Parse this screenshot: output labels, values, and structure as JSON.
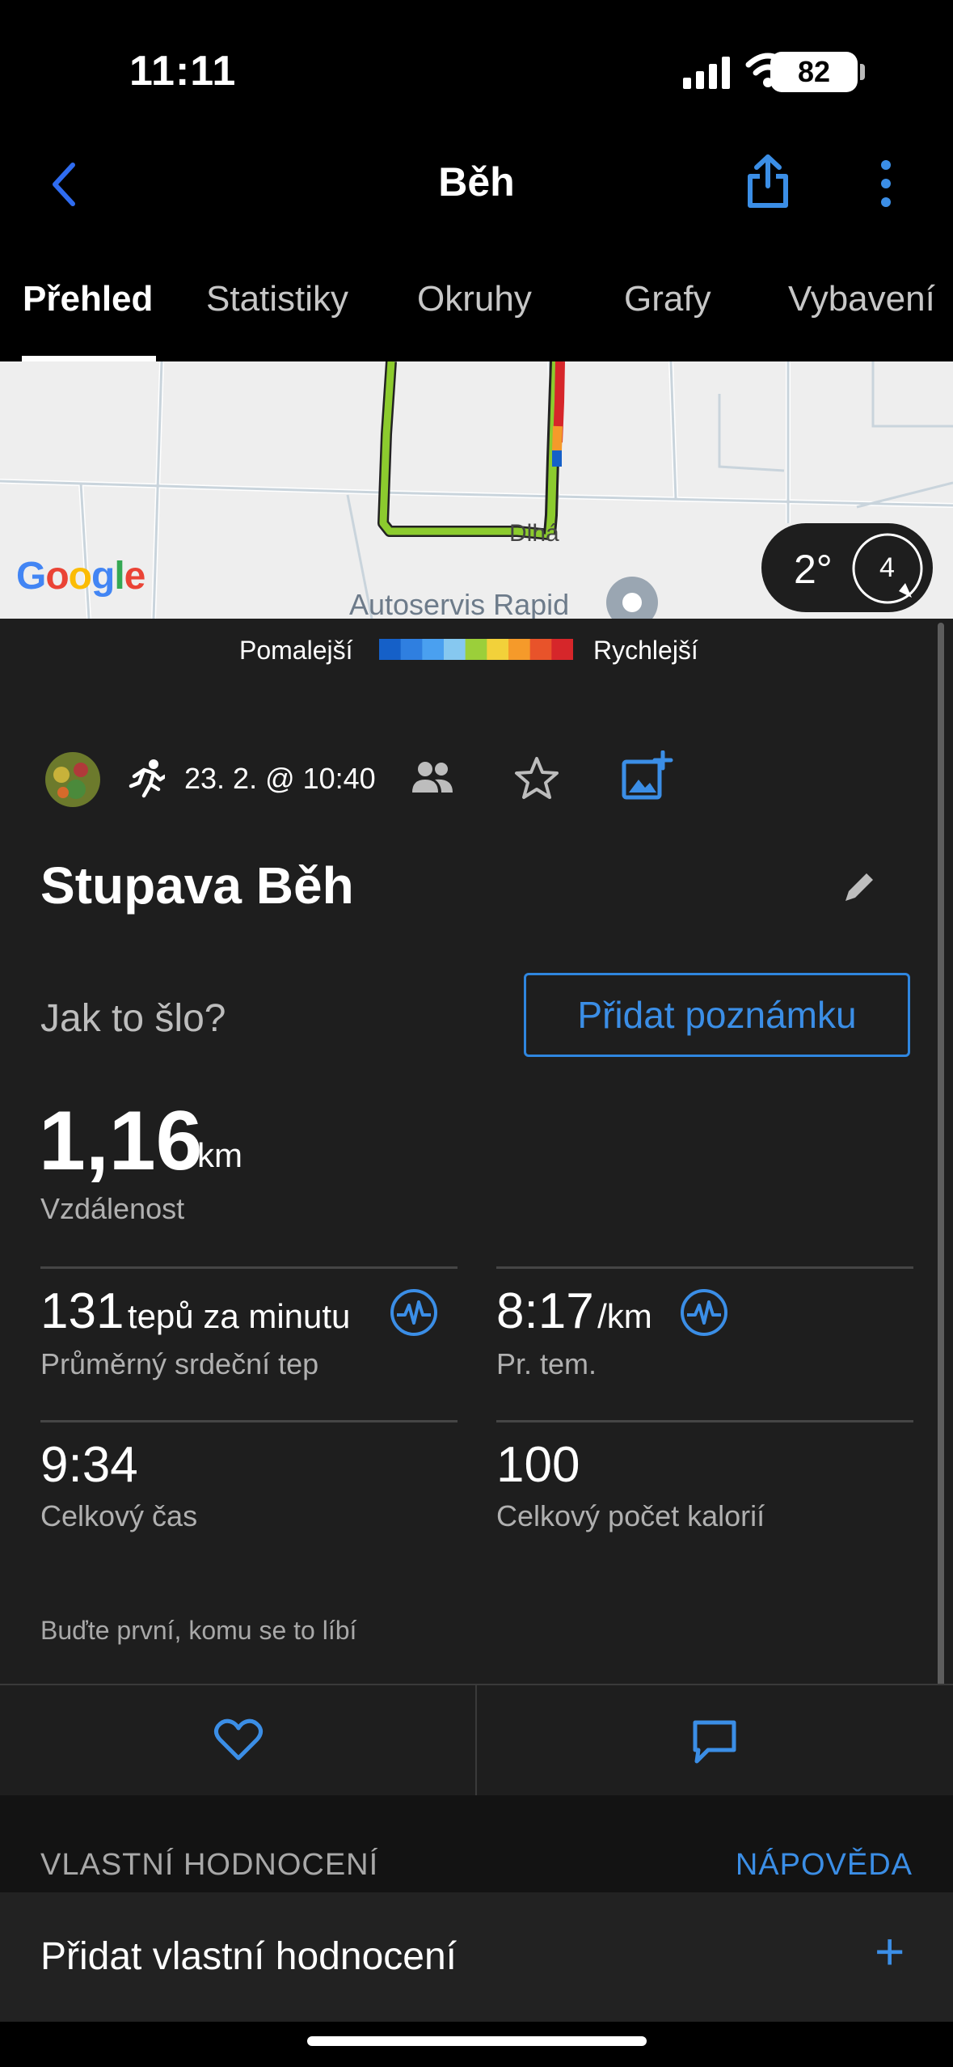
{
  "status_bar": {
    "time": "11:11",
    "battery": "82"
  },
  "header": {
    "title": "Běh"
  },
  "tabs": [
    {
      "label": "Přehled",
      "active": true
    },
    {
      "label": "Statistiky"
    },
    {
      "label": "Okruhy"
    },
    {
      "label": "Grafy"
    },
    {
      "label": "Vybavení"
    }
  ],
  "map": {
    "google_logo": "Google",
    "street": "Dlhá",
    "poi": "Autoservis Rapid",
    "temperature": "2°",
    "wind": "4"
  },
  "pace_legend": {
    "slow": "Pomalejší",
    "fast": "Rychlejší",
    "colors": [
      "#1560c8",
      "#2f7fe0",
      "#4aa0f0",
      "#86c8f0",
      "#9bcf3a",
      "#f2d13a",
      "#f59a2a",
      "#e8532a",
      "#d6262a"
    ]
  },
  "activity": {
    "date": "23. 2. @ 10:40",
    "title": "Stupava Běh"
  },
  "note": {
    "prompt": "Jak to šlo?",
    "button": "Přidat poznámku"
  },
  "stats": {
    "distance": {
      "value": "1,16",
      "unit": "km",
      "label": "Vzdálenost"
    },
    "heart_rate": {
      "value": "131",
      "unit": "tepů za minutu",
      "label": "Průměrný srdeční tep"
    },
    "pace": {
      "value": "8:17",
      "unit": "/km",
      "label": "Pr. tem."
    },
    "time": {
      "value": "9:34",
      "label": "Celkový čas"
    },
    "calories": {
      "value": "100",
      "label": "Celkový počet kalorií"
    }
  },
  "social": {
    "first_like": "Buďte první, komu se to líbí"
  },
  "custom_rating": {
    "title": "VLASTNÍ HODNOCENÍ",
    "help": "NÁPOVĚDA",
    "add": "Přidat vlastní hodnocení",
    "plus": "+"
  },
  "colors": {
    "accent": "#3b8ee6",
    "background": "#1e1e1e",
    "header_bg": "#000000"
  }
}
